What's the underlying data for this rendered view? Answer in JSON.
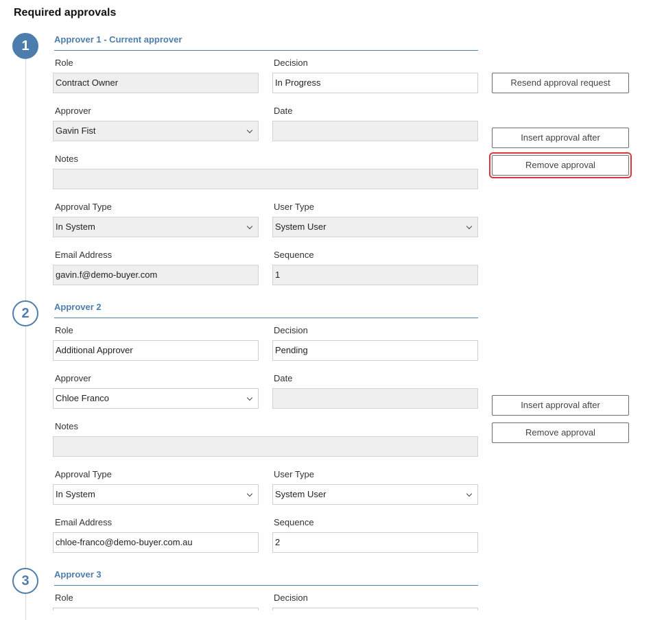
{
  "page": {
    "title": "Required approvals"
  },
  "labels": {
    "role": "Role",
    "decision": "Decision",
    "approver": "Approver",
    "date": "Date",
    "notes": "Notes",
    "approval_type": "Approval Type",
    "user_type": "User Type",
    "email_address": "Email Address",
    "sequence": "Sequence"
  },
  "buttons": {
    "resend": "Resend approval request",
    "insert_after": "Insert approval after",
    "remove": "Remove approval"
  },
  "approvers": [
    {
      "step": "1",
      "heading": "Approver 1 - Current approver",
      "role": "Contract Owner",
      "decision": "In Progress",
      "approver": "Gavin Fist",
      "date": "",
      "notes": "",
      "approval_type": "In System",
      "user_type": "System User",
      "email": "gavin.f@demo-buyer.com",
      "sequence": "1"
    },
    {
      "step": "2",
      "heading": "Approver 2",
      "role": "Additional Approver",
      "decision": "Pending",
      "approver": "Chloe Franco",
      "date": "",
      "notes": "",
      "approval_type": "In System",
      "user_type": "System User",
      "email": "chloe-franco@demo-buyer.com.au",
      "sequence": "2"
    },
    {
      "step": "3",
      "heading": "Approver 3",
      "role": "",
      "decision": ""
    }
  ],
  "colors": {
    "accent": "#4d7dac",
    "highlight": "#d9363e",
    "readonly_bg": "#efefef"
  }
}
